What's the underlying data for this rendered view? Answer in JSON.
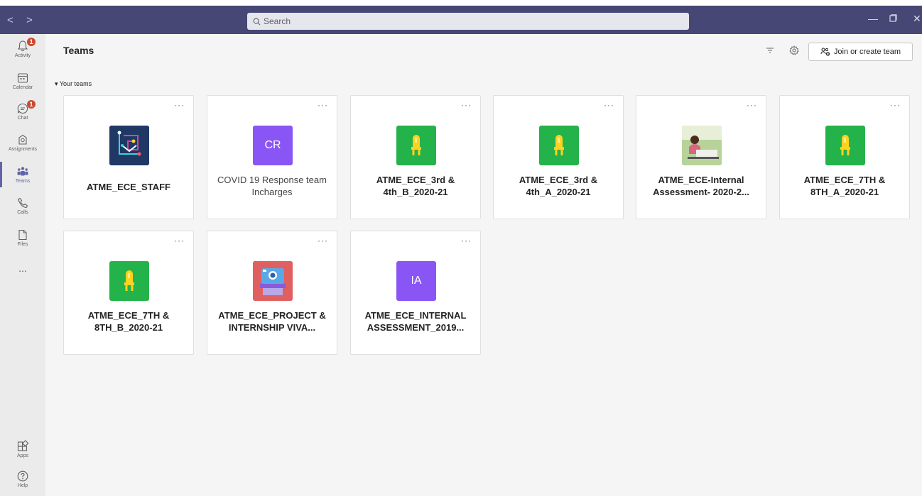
{
  "titlebar": {
    "search_placeholder": "Search",
    "back_glyph": "<",
    "forward_glyph": ">"
  },
  "rail": {
    "items": [
      {
        "label": "Activity",
        "icon": "bell-icon",
        "badge": "1"
      },
      {
        "label": "Calendar",
        "icon": "calendar-icon"
      },
      {
        "label": "Chat",
        "icon": "chat-icon",
        "badge": "1"
      },
      {
        "label": "Assignments",
        "icon": "assignments-icon"
      },
      {
        "label": "Teams",
        "icon": "teams-icon",
        "active": true
      },
      {
        "label": "Calls",
        "icon": "phone-icon"
      },
      {
        "label": "Files",
        "icon": "file-icon"
      },
      {
        "label": "...",
        "icon": "more-icon"
      }
    ],
    "bottom": [
      {
        "label": "Apps",
        "icon": "apps-icon"
      },
      {
        "label": "Help",
        "icon": "help-icon"
      }
    ]
  },
  "header": {
    "title": "Teams",
    "join_label": "Join or create team"
  },
  "section_label": "Your teams",
  "teams": [
    {
      "name": "ATME_ECE_STAFF",
      "tile": "circuit",
      "color": "#1f3864"
    },
    {
      "name": "COVID 19 Response team Incharges",
      "tile": "initials",
      "initials": "CR",
      "color": "#8a55f5"
    },
    {
      "name": "ATME_ECE_3rd & 4th_B_2020-21",
      "tile": "led",
      "color": "#24b24a"
    },
    {
      "name": "ATME_ECE_3rd & 4th_A_2020-21",
      "tile": "led",
      "color": "#24b24a"
    },
    {
      "name": "ATME_ECE-Internal Assessment- 2020-2...",
      "tile": "photo",
      "color": "#a8c68f"
    },
    {
      "name": "ATME_ECE_7TH & 8TH_A_2020-21",
      "tile": "led",
      "color": "#24b24a"
    },
    {
      "name": "ATME_ECE_7TH & 8TH_B_2020-21",
      "tile": "led",
      "color": "#24b24a"
    },
    {
      "name": "ATME_ECE_PROJECT & INTERNSHIP VIVA...",
      "tile": "camera",
      "color": "#e06060"
    },
    {
      "name": "ATME_ECE_INTERNAL ASSESSMENT_2019...",
      "tile": "initials",
      "initials": "IA",
      "color": "#8a55f5"
    }
  ],
  "colors": {
    "titlebar": "#464775",
    "accent": "#6264a7",
    "badge": "#cc4a31"
  }
}
